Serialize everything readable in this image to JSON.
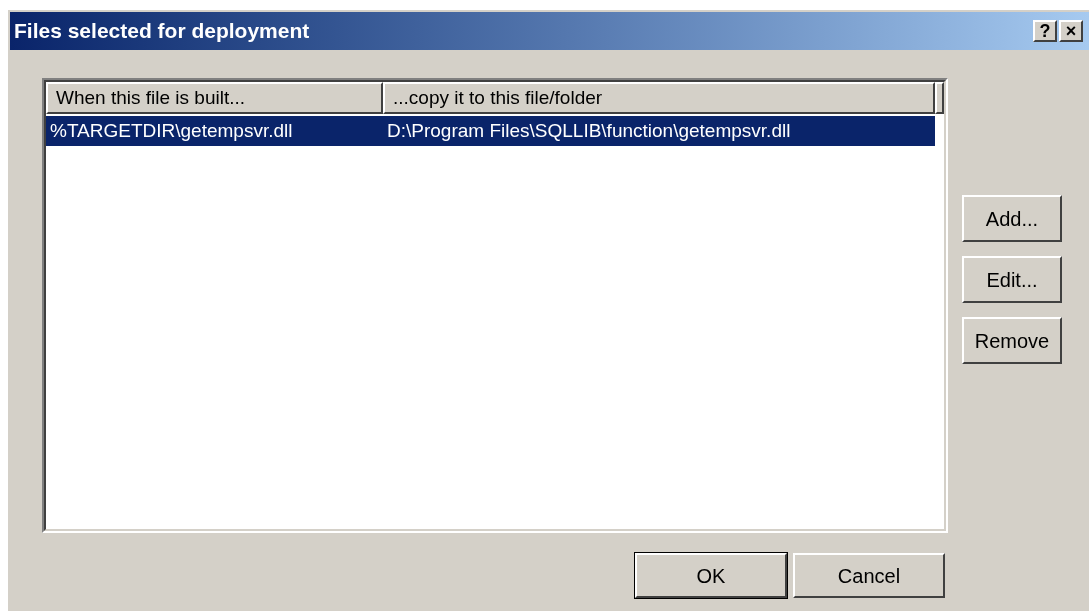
{
  "window": {
    "title": "Files selected for deployment",
    "title_buttons": [
      "?",
      "×"
    ]
  },
  "table": {
    "columns": [
      "When this file is built...",
      "...copy it to this file/folder"
    ],
    "rows": [
      {
        "cells": [
          "%TARGETDIR\\getempsvr.dll",
          "D:\\Program Files\\SQLLIB\\function\\getempsvr.dll"
        ],
        "selected": true
      }
    ]
  },
  "side_buttons": [
    "Add...",
    "Edit...",
    "Remove"
  ],
  "footer_buttons": [
    {
      "label": "OK",
      "default": true
    },
    {
      "label": "Cancel",
      "default": false
    }
  ]
}
